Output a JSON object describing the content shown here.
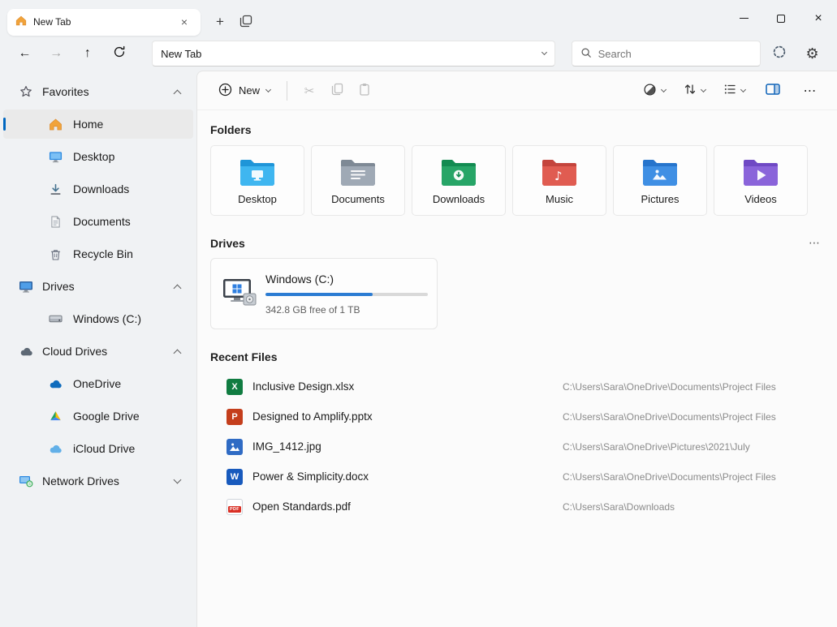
{
  "colors": {
    "accent_blue": "#0067c0",
    "progress_fill": "#2b7cd3",
    "excel_green": "#107c41",
    "powerpoint_orange": "#c43e1c",
    "word_blue": "#185abd",
    "pdf_red": "#d93025",
    "image_blue": "#2f6bc4",
    "selected_sidebar_bg": "#eaeaea"
  },
  "icons": {
    "back": "←",
    "forward": "→",
    "up": "↑",
    "new_tab": "+",
    "tab_close": "×",
    "window_close": "×",
    "cut": "✂",
    "gear": "⚙",
    "more": "•••",
    "music_note": "♪"
  },
  "titlebar": {
    "tab_title": "New Tab"
  },
  "navbar": {
    "address": "New Tab",
    "search_placeholder": "Search"
  },
  "commandbar": {
    "new_label": "New"
  },
  "sidebar": {
    "sections": {
      "favorites": {
        "label": "Favorites",
        "items": [
          "Home",
          "Desktop",
          "Downloads",
          "Documents",
          "Recycle Bin"
        ]
      },
      "drives": {
        "label": "Drives",
        "items": [
          "Windows (C:)"
        ]
      },
      "cloud": {
        "label": "Cloud Drives",
        "items": [
          "OneDrive",
          "Google Drive",
          "iCloud Drive"
        ]
      },
      "network": {
        "label": "Network Drives"
      }
    }
  },
  "main": {
    "folders_heading": "Folders",
    "folders": [
      {
        "label": "Desktop",
        "color": "#3fb6f0",
        "color_dark": "#1f95d8"
      },
      {
        "label": "Documents",
        "color": "#9fa9b5",
        "color_dark": "#7e8995"
      },
      {
        "label": "Downloads",
        "color": "#27a567",
        "color_dark": "#128b51"
      },
      {
        "label": "Music",
        "color": "#e05c51",
        "color_dark": "#c4443c"
      },
      {
        "label": "Pictures",
        "color": "#3f8fe4",
        "color_dark": "#2674cc"
      },
      {
        "label": "Videos",
        "color": "#8a64da",
        "color_dark": "#6f49c4"
      }
    ],
    "drives_heading": "Drives",
    "drive": {
      "name": "Windows (C:)",
      "usage_percent": 66,
      "free_text": "342.8 GB free of 1 TB"
    },
    "recent_heading": "Recent Files",
    "recent_files": [
      {
        "name": "Inclusive Design.xlsx",
        "path": "C:\\Users\\Sara\\OneDrive\\Documents\\Project Files",
        "badge": "X"
      },
      {
        "name": "Designed to Amplify.pptx",
        "path": "C:\\Users\\Sara\\OneDrive\\Documents\\Project Files",
        "badge": "P"
      },
      {
        "name": "IMG_1412.jpg",
        "path": "C:\\Users\\Sara\\OneDrive\\Pictures\\2021\\July",
        "badge": ""
      },
      {
        "name": "Power & Simplicity.docx",
        "path": "C:\\Users\\Sara\\OneDrive\\Documents\\Project Files",
        "badge": "W"
      },
      {
        "name": "Open Standards.pdf",
        "path": "C:\\Users\\Sara\\Downloads",
        "badge": "PDF"
      }
    ]
  }
}
